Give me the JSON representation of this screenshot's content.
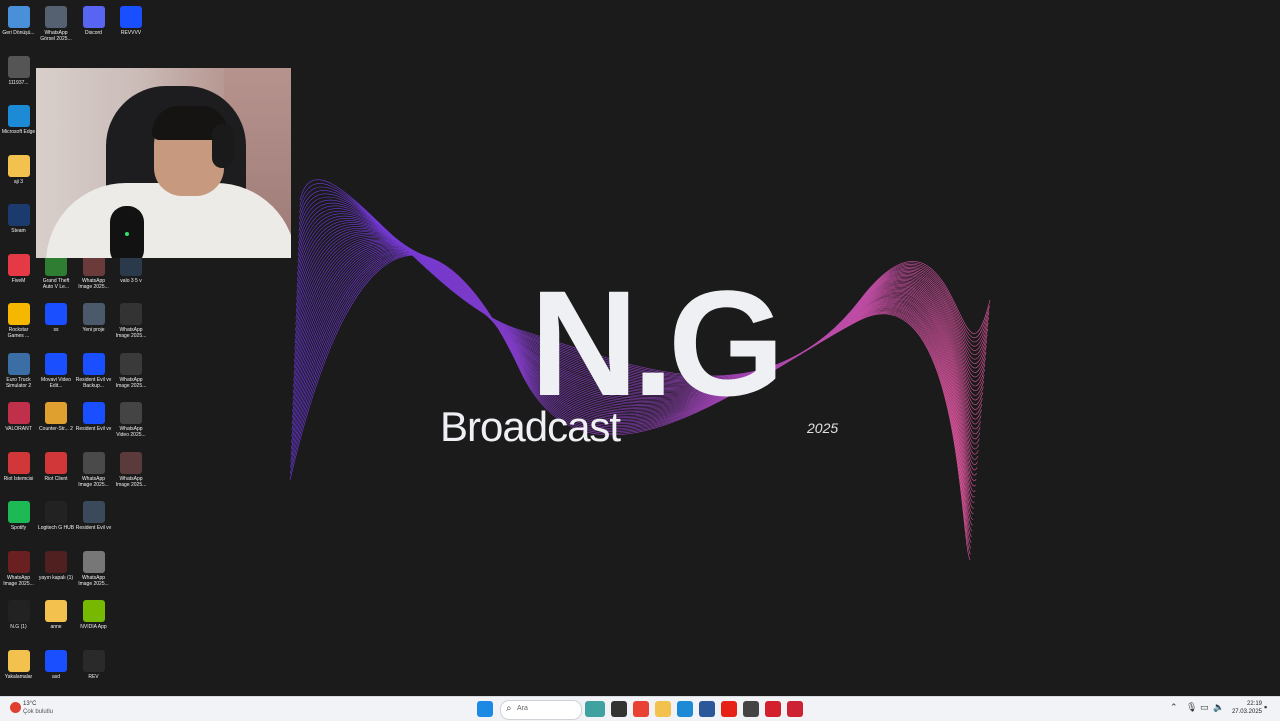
{
  "desktop": {
    "icons": [
      {
        "label": "Geri Dönüşü...",
        "icon": "recycle-bin-icon",
        "color": "#4a90d9"
      },
      {
        "label": "WhatsApp Görsel 2025...",
        "icon": "image-icon",
        "color": "#556070"
      },
      {
        "label": "Discord",
        "icon": "discord-icon",
        "color": "#5865f2"
      },
      {
        "label": "REVVVV",
        "icon": "app-icon",
        "color": "#1a4fff"
      },
      {
        "label": "111937...",
        "icon": "image-icon",
        "color": "#555"
      },
      {
        "label": "Microsoft Edge",
        "icon": "edge-icon",
        "color": "#1d8ad6"
      },
      {
        "label": "aji 3",
        "icon": "folder-icon",
        "color": "#f2c14e"
      },
      {
        "label": "Steam",
        "icon": "steam-icon",
        "color": "#1b3b6f"
      },
      {
        "label": "FiveM",
        "icon": "fivem-icon",
        "color": "#e63946"
      },
      {
        "label": "Grand Theft Auto V Le...",
        "icon": "gta-icon",
        "color": "#2e7d32"
      },
      {
        "label": "WhatsApp Image 2025...",
        "icon": "image-icon",
        "color": "#6b3a3a"
      },
      {
        "label": "valo 3 5 v",
        "icon": "image-icon",
        "color": "#2b3a4a"
      },
      {
        "label": "Rockstar Games ...",
        "icon": "rockstar-icon",
        "color": "#f5b700"
      },
      {
        "label": "ss",
        "icon": "app-icon",
        "color": "#1a4fff"
      },
      {
        "label": "Yeni proje",
        "icon": "image-icon",
        "color": "#4a5a6a"
      },
      {
        "label": "WhatsApp Image 2025...",
        "icon": "image-icon",
        "color": "#333"
      },
      {
        "label": "Euro Truck Simulator 2",
        "icon": "truck-icon",
        "color": "#3a6ea5"
      },
      {
        "label": "Movavi Video Edit...",
        "icon": "app-icon",
        "color": "#1a4fff"
      },
      {
        "label": "Resident Evil vv Backup...",
        "icon": "app-icon",
        "color": "#1a4fff"
      },
      {
        "label": "WhatsApp Image 2025...",
        "icon": "image-icon",
        "color": "#3a3a3a"
      },
      {
        "label": "VALORANT",
        "icon": "valorant-icon",
        "color": "#c0304a"
      },
      {
        "label": "Counter-Str... 2",
        "icon": "cs2-icon",
        "color": "#e0a030"
      },
      {
        "label": "Resident Evil vv",
        "icon": "app-icon",
        "color": "#1a4fff"
      },
      {
        "label": "WhatsApp Video 2025...",
        "icon": "video-icon",
        "color": "#444"
      },
      {
        "label": "Riot İstemcisi",
        "icon": "riot-icon",
        "color": "#d13639"
      },
      {
        "label": "Riot Client",
        "icon": "riot-icon",
        "color": "#d13639"
      },
      {
        "label": "WhatsApp Image 2025...",
        "icon": "image-icon",
        "color": "#4a4a4a"
      },
      {
        "label": "WhatsApp Image 2025...",
        "icon": "image-icon",
        "color": "#5a3a3a"
      },
      {
        "label": "Spotify",
        "icon": "spotify-icon",
        "color": "#1db954"
      },
      {
        "label": "Logitech G HUB",
        "icon": "logitech-icon",
        "color": "#222"
      },
      {
        "label": "Resident Evil vv",
        "icon": "image-icon",
        "color": "#3a4a5a"
      },
      {
        "label": "WhatsApp Image 2025...",
        "icon": "image-icon",
        "color": "#6a2020"
      },
      {
        "label": "yayın kapalı (1)",
        "icon": "image-icon",
        "color": "#502020"
      },
      {
        "label": "WhatsApp Image 2025...",
        "icon": "image-icon",
        "color": "#777"
      },
      {
        "label": "N.G (1)",
        "icon": "image-icon",
        "color": "#222"
      },
      {
        "label": "anne",
        "icon": "folder-icon",
        "color": "#f2c14e"
      },
      {
        "label": "NVIDIA App",
        "icon": "nvidia-icon",
        "color": "#76b900"
      },
      {
        "label": "Yakalamalar",
        "icon": "folder-icon",
        "color": "#f2c14e"
      },
      {
        "label": "asd",
        "icon": "app-icon",
        "color": "#1a4fff"
      },
      {
        "label": "REV",
        "icon": "image-icon",
        "color": "#2a2a2a"
      }
    ]
  },
  "wallpaper": {
    "brand": "N.G",
    "subtitle": "Broadcast",
    "year": "2025"
  },
  "taskbar": {
    "weather": {
      "temp": "13°C",
      "condition": "Çok bulutlu"
    },
    "search_placeholder": "Ara",
    "pinned": [
      {
        "icon": "windows-start-icon",
        "color": "#1e88e5"
      },
      {
        "icon": "search-icon",
        "color": "#444"
      },
      {
        "icon": "copilot-icon",
        "color": "#3fa2a0"
      },
      {
        "icon": "task-view-icon",
        "color": "#333"
      },
      {
        "icon": "chrome-icon",
        "color": "#e94235"
      },
      {
        "icon": "file-explorer-icon",
        "color": "#f2c14e"
      },
      {
        "icon": "edge-icon",
        "color": "#1d8ad6"
      },
      {
        "icon": "app-icon",
        "color": "#2b579a"
      },
      {
        "icon": "youtube-icon",
        "color": "#e62117"
      },
      {
        "icon": "app-icon",
        "color": "#444"
      },
      {
        "icon": "opera-icon",
        "color": "#d3202c"
      },
      {
        "icon": "app-icon",
        "color": "#cc2233"
      }
    ],
    "clock": {
      "time": "22:19",
      "date": "27.03.2025"
    }
  }
}
